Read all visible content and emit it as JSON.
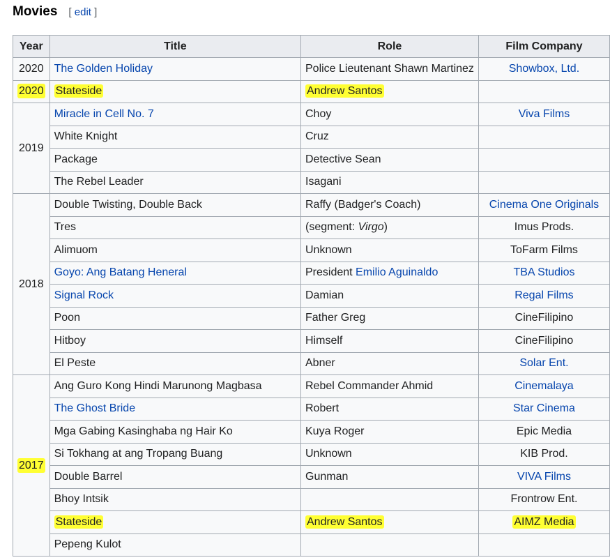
{
  "section": {
    "title": "Movies",
    "edit_open": "[",
    "edit_label": "edit",
    "edit_close": "]"
  },
  "table": {
    "headers": [
      "Year",
      "Title",
      "Role",
      "Film Company"
    ],
    "years": {
      "y2020a": "2020",
      "y2020b": "2020",
      "y2019": "2019",
      "y2018": "2018",
      "y2017": "2017"
    },
    "rows": [
      {
        "title": "The Golden Holiday",
        "role": "Police Lieutenant Shawn Martinez",
        "company": "Showbox, Ltd."
      },
      {
        "title": "Stateside",
        "role": "Andrew Santos",
        "company": ""
      },
      {
        "title": "Miracle in Cell No. 7",
        "role": "Choy",
        "company": "Viva Films"
      },
      {
        "title": "White Knight",
        "role": "Cruz",
        "company": ""
      },
      {
        "title": "Package",
        "role": "Detective Sean",
        "company": ""
      },
      {
        "title": "The Rebel Leader",
        "role": "Isagani",
        "company": ""
      },
      {
        "title": "Double Twisting, Double Back",
        "role": "Raffy (Badger's Coach)",
        "company": "Cinema One Originals"
      },
      {
        "title": "Tres",
        "role_prefix": "(segment: ",
        "role_italic": "Virgo",
        "role_suffix": ")",
        "company": "Imus Prods."
      },
      {
        "title": "Alimuom",
        "role": "Unknown",
        "company": "ToFarm Films"
      },
      {
        "title": "Goyo: Ang Batang Heneral",
        "role_prefix": "President ",
        "role_link": "Emilio Aguinaldo",
        "company": "TBA Studios"
      },
      {
        "title": "Signal Rock",
        "role": "Damian",
        "company": "Regal Films"
      },
      {
        "title": "Poon",
        "role": "Father Greg",
        "company": "CineFilipino"
      },
      {
        "title": "Hitboy",
        "role": "Himself",
        "company": "CineFilipino"
      },
      {
        "title": "El Peste",
        "role": "Abner",
        "company": "Solar Ent."
      },
      {
        "title": "Ang Guro Kong Hindi Marunong Magbasa",
        "role": "Rebel Commander Ahmid",
        "company": "Cinemalaya"
      },
      {
        "title": "The Ghost Bride",
        "role": "Robert",
        "company": "Star Cinema"
      },
      {
        "title": "Mga Gabing Kasinghaba ng Hair Ko",
        "role": "Kuya Roger",
        "company": "Epic Media"
      },
      {
        "title": "Si Tokhang at ang Tropang Buang",
        "role": "Unknown",
        "company": "KIB Prod."
      },
      {
        "title": "Double Barrel",
        "role": "Gunman",
        "company": "VIVA Films"
      },
      {
        "title": "Bhoy Intsik",
        "role": "",
        "company": "Frontrow Ent."
      },
      {
        "title": "Stateside",
        "role": "Andrew Santos",
        "company": "AIMZ Media"
      },
      {
        "title": "Pepeng Kulot",
        "role": "",
        "company": ""
      }
    ]
  },
  "colors": {
    "link": "#0645ad",
    "highlight": "#ffff33",
    "header_bg": "#eaecf0",
    "cell_bg": "#f8f9fa",
    "border": "#a2a9b1"
  }
}
